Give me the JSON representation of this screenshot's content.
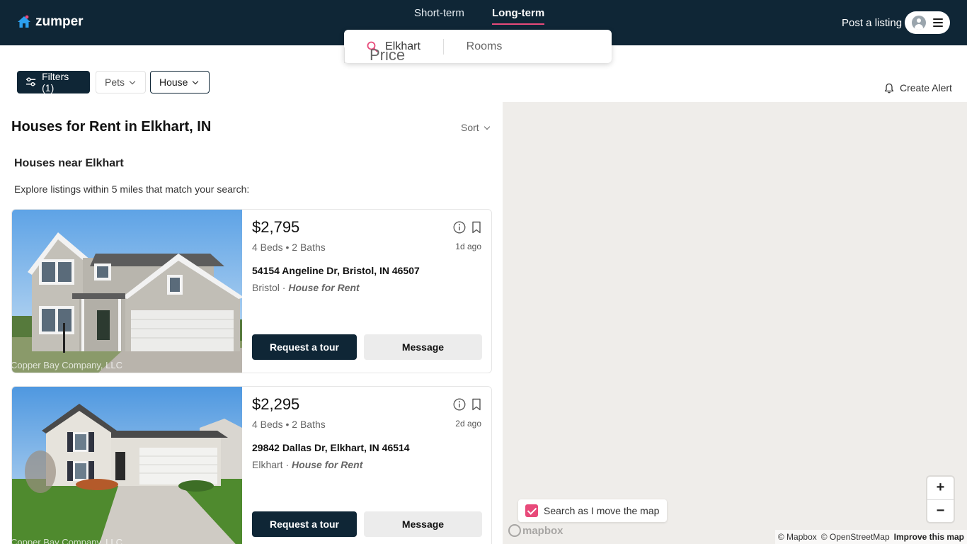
{
  "header": {
    "brand": "zumper",
    "modes": [
      {
        "label": "Short-term",
        "active": false
      },
      {
        "label": "Long-term",
        "active": true
      }
    ],
    "post_listing": "Post a listing"
  },
  "search": {
    "location": "Elkhart",
    "price": "Price",
    "rooms": "Rooms"
  },
  "filters": {
    "filters_label": "Filters (1)",
    "pets_label": "Pets",
    "house_label": "House",
    "create_alert": "Create Alert"
  },
  "results": {
    "title": "Houses for Rent in Elkhart, IN",
    "sort_label": "Sort",
    "section_title": "Houses near Elkhart",
    "section_subtitle": "Explore listings within 5 miles that match your search:"
  },
  "listings": [
    {
      "price": "$2,795",
      "beds_baths": "4 Beds • 2 Baths",
      "posted": "1d ago",
      "address": "54154 Angeline Dr, Bristol, IN 46507",
      "neighborhood": "Bristol",
      "separator": " · ",
      "type": "House for Rent",
      "watermark": "Copper Bay Company, LLC",
      "tour_label": "Request a tour",
      "message_label": "Message"
    },
    {
      "price": "$2,295",
      "beds_baths": "4 Beds • 2 Baths",
      "posted": "2d ago",
      "address": "29842 Dallas Dr, Elkhart, IN 46514",
      "neighborhood": "Elkhart",
      "separator": " · ",
      "type": "House for Rent",
      "watermark": "Copper Bay Company, LLC",
      "tour_label": "Request a tour",
      "message_label": "Message"
    }
  ],
  "map": {
    "search_toggle_label": "Search as I move the map",
    "search_toggle_checked": true,
    "zoom_in": "+",
    "zoom_out": "−",
    "logo": "mapbox",
    "attribution_mapbox": "© Mapbox",
    "attribution_osm": "© OpenStreetMap",
    "improve": "Improve this map"
  },
  "colors": {
    "navy": "#0f2636",
    "accent_pink": "#e84a7a",
    "brand_blue": "#2ba0f0",
    "map_bg": "#efedea"
  }
}
